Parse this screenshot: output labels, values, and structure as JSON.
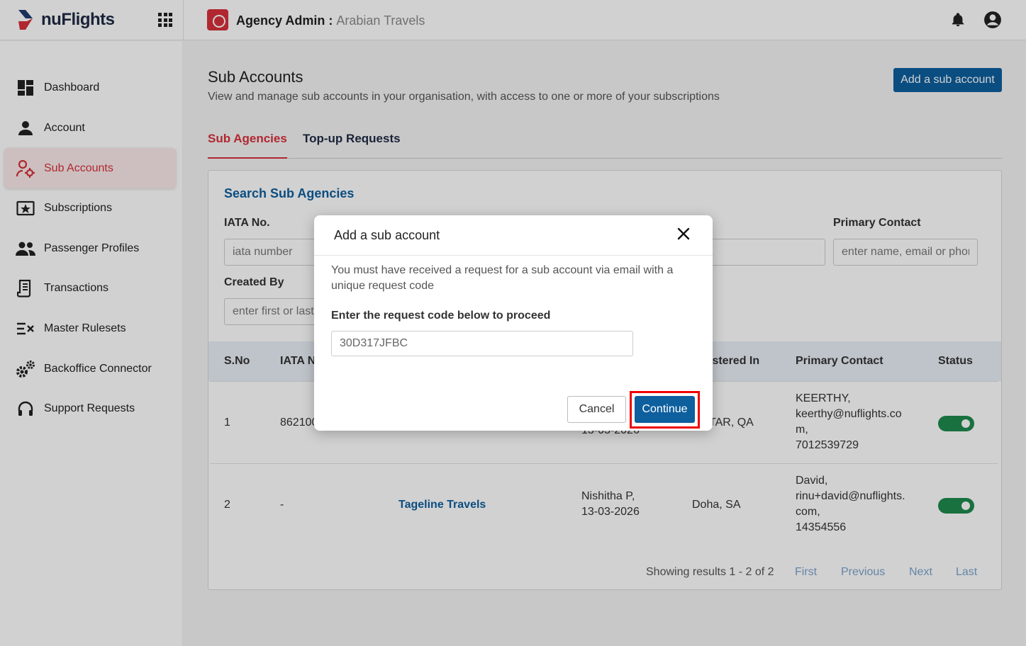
{
  "header": {
    "brand": "nuFlights",
    "title_prefix": "Agency Admin :",
    "agency_name": "Arabian Travels"
  },
  "sidebar": {
    "items": [
      {
        "label": "Dashboard",
        "icon": "dashboard-icon"
      },
      {
        "label": "Account",
        "icon": "person-icon"
      },
      {
        "label": "Sub Accounts",
        "icon": "user-gear-icon",
        "active": true
      },
      {
        "label": "Subscriptions",
        "icon": "star-ticket-icon"
      },
      {
        "label": "Passenger Profiles",
        "icon": "people-icon"
      },
      {
        "label": "Transactions",
        "icon": "receipt-icon"
      },
      {
        "label": "Master Rulesets",
        "icon": "ruleset-icon"
      },
      {
        "label": "Backoffice Connector",
        "icon": "gears-icon"
      },
      {
        "label": "Support Requests",
        "icon": "headset-icon"
      }
    ]
  },
  "page": {
    "title": "Sub Accounts",
    "subtitle": "View and manage sub accounts in your organisation, with access to one or more of your subscriptions",
    "add_button": "Add a sub account",
    "tabs": [
      {
        "label": "Sub Agencies",
        "active": true
      },
      {
        "label": "Top-up Requests",
        "active": false
      }
    ]
  },
  "search": {
    "title": "Search Sub Agencies",
    "iata_label": "IATA No.",
    "iata_placeholder": "iata number",
    "primary_contact_label": "Primary Contact",
    "primary_contact_placeholder": "enter name, email or phone",
    "created_by_label": "Created By",
    "created_by_placeholder": "enter first or last name"
  },
  "table": {
    "headers": [
      "S.No",
      "IATA N",
      "istered In",
      "Primary Contact",
      "Status"
    ],
    "rows": [
      {
        "sno": "1",
        "iata": "862100",
        "created_frag": "13-03-2026",
        "registered_in": "TAR, QA",
        "contact_lines": [
          "KEERTHY,",
          "keerthy@nuflights.co",
          "m,",
          "7012539729"
        ],
        "status_on": true
      },
      {
        "sno": "2",
        "iata": "-",
        "name": "Tageline Travels",
        "created_lines": [
          "Nishitha P,",
          "13-03-2026"
        ],
        "registered_in": "Doha, SA",
        "contact_lines": [
          "David,",
          "rinu+david@nuflights.",
          "com,",
          "14354556"
        ],
        "status_on": true
      }
    ]
  },
  "pagination": {
    "info": "Showing results 1 - 2 of 2",
    "first": "First",
    "previous": "Previous",
    "next": "Next",
    "last": "Last"
  },
  "modal": {
    "title": "Add a sub account",
    "message": "You must have received a request for a sub account via email with a unique request code",
    "code_label": "Enter the request code below to proceed",
    "code_value": "30D317JFBC",
    "cancel_label": "Cancel",
    "continue_label": "Continue"
  },
  "colors": {
    "accent_red": "#d7303b",
    "primary_blue": "#0d5f9e",
    "toggle_green": "#1e8a4c",
    "highlight_outline": "#ee0000"
  }
}
